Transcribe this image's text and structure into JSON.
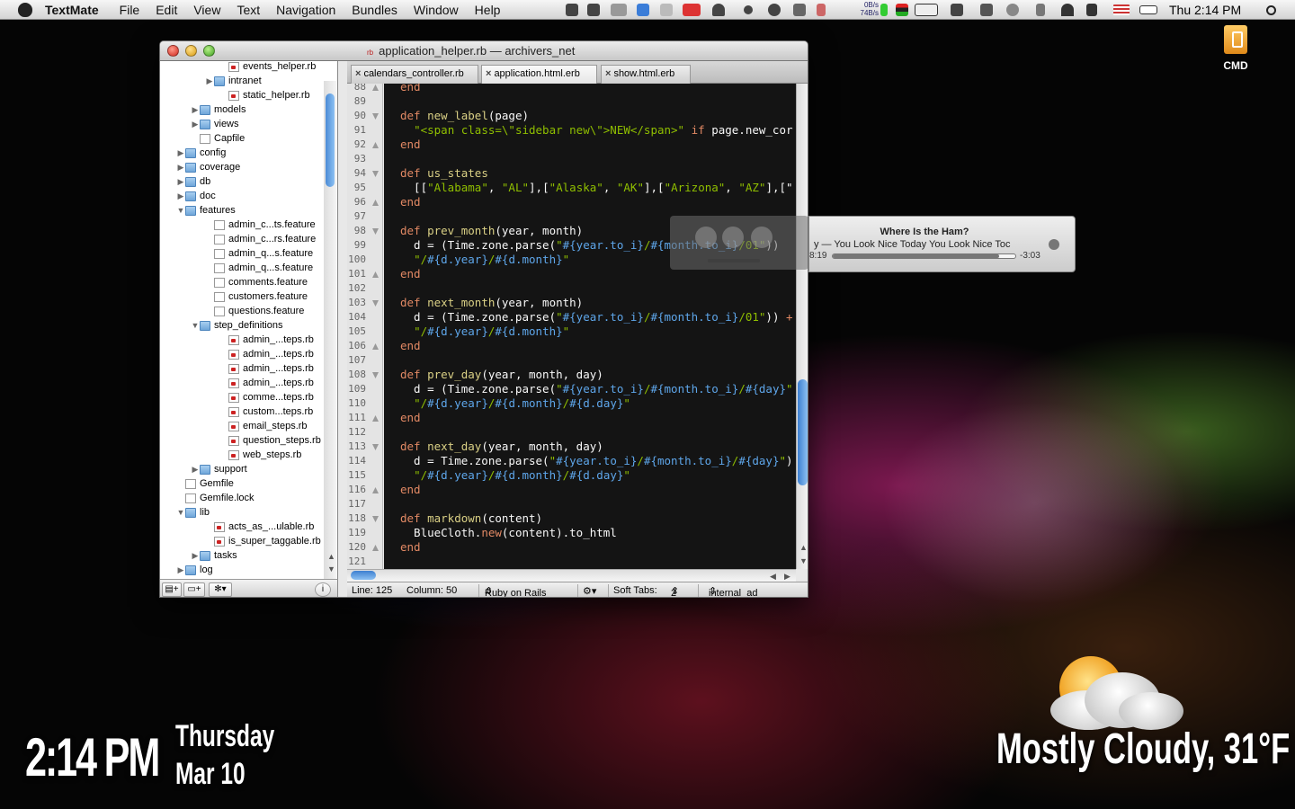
{
  "menubar": {
    "app": "TextMate",
    "items": [
      "File",
      "Edit",
      "View",
      "Text",
      "Navigation",
      "Bundles",
      "Window",
      "Help"
    ],
    "net_up": "0B/s",
    "net_down": "74B/s",
    "clock": "Thu 2:14 PM"
  },
  "desktop": {
    "drive_label": "CMD"
  },
  "window": {
    "title": "application_helper.rb — archivers_net",
    "file_badge": "rb",
    "tabs": [
      "calendars_controller.rb",
      "application.html.erb",
      "show.html.erb"
    ]
  },
  "project_tree": [
    {
      "label": "events_helper.rb",
      "type": "rb",
      "depth": 3
    },
    {
      "label": "intranet",
      "type": "folder",
      "depth": 2,
      "tri": "▶"
    },
    {
      "label": "static_helper.rb",
      "type": "rb",
      "depth": 3
    },
    {
      "label": "models",
      "type": "folder",
      "depth": 1,
      "tri": "▶"
    },
    {
      "label": "views",
      "type": "folder",
      "depth": 1,
      "tri": "▶"
    },
    {
      "label": "Capfile",
      "type": "doc",
      "depth": 1
    },
    {
      "label": "config",
      "type": "folder",
      "depth": 0,
      "tri": "▶"
    },
    {
      "label": "coverage",
      "type": "folder",
      "depth": 0,
      "tri": "▶"
    },
    {
      "label": "db",
      "type": "folder",
      "depth": 0,
      "tri": "▶"
    },
    {
      "label": "doc",
      "type": "folder",
      "depth": 0,
      "tri": "▶"
    },
    {
      "label": "features",
      "type": "folder",
      "depth": 0,
      "tri": "▼"
    },
    {
      "label": "admin_c...ts.feature",
      "type": "doc",
      "depth": 2
    },
    {
      "label": "admin_c...rs.feature",
      "type": "doc",
      "depth": 2
    },
    {
      "label": "admin_q...s.feature",
      "type": "doc",
      "depth": 2
    },
    {
      "label": "admin_q...s.feature",
      "type": "doc",
      "depth": 2
    },
    {
      "label": "comments.feature",
      "type": "doc",
      "depth": 2
    },
    {
      "label": "customers.feature",
      "type": "doc",
      "depth": 2
    },
    {
      "label": "questions.feature",
      "type": "doc",
      "depth": 2
    },
    {
      "label": "step_definitions",
      "type": "folder",
      "depth": 1,
      "tri": "▼"
    },
    {
      "label": "admin_...teps.rb",
      "type": "rb",
      "depth": 3
    },
    {
      "label": "admin_...teps.rb",
      "type": "rb",
      "depth": 3
    },
    {
      "label": "admin_...teps.rb",
      "type": "rb",
      "depth": 3
    },
    {
      "label": "admin_...teps.rb",
      "type": "rb",
      "depth": 3
    },
    {
      "label": "comme...teps.rb",
      "type": "rb",
      "depth": 3
    },
    {
      "label": "custom...teps.rb",
      "type": "rb",
      "depth": 3
    },
    {
      "label": "email_steps.rb",
      "type": "rb",
      "depth": 3
    },
    {
      "label": "question_steps.rb",
      "type": "rb",
      "depth": 3
    },
    {
      "label": "web_steps.rb",
      "type": "rb",
      "depth": 3
    },
    {
      "label": "support",
      "type": "folder",
      "depth": 1,
      "tri": "▶"
    },
    {
      "label": "Gemfile",
      "type": "doc",
      "depth": 0
    },
    {
      "label": "Gemfile.lock",
      "type": "doc",
      "depth": 0
    },
    {
      "label": "lib",
      "type": "folder",
      "depth": 0,
      "tri": "▼"
    },
    {
      "label": "acts_as_...ulable.rb",
      "type": "rb",
      "depth": 2
    },
    {
      "label": "is_super_taggable.rb",
      "type": "rb",
      "depth": 2
    },
    {
      "label": "tasks",
      "type": "folder",
      "depth": 1,
      "tri": "▶"
    },
    {
      "label": "log",
      "type": "folder",
      "depth": 0,
      "tri": "▶"
    }
  ],
  "code": [
    {
      "n": "88",
      "f": "up",
      "t": [
        [
          "kw",
          "end"
        ]
      ]
    },
    {
      "n": "89",
      "t": []
    },
    {
      "n": "90",
      "f": "down",
      "t": [
        [
          "kw",
          "def "
        ],
        [
          "mt",
          "new_label"
        ],
        [
          "",
          "(page)"
        ]
      ]
    },
    {
      "n": "91",
      "t": [
        [
          "",
          "  "
        ],
        [
          "st",
          "\"<span class=\\\"sidebar new\\\">NEW</span>\""
        ],
        [
          "kw",
          " if "
        ],
        [
          "",
          "page.new_cor"
        ]
      ]
    },
    {
      "n": "92",
      "f": "up",
      "t": [
        [
          "kw",
          "end"
        ]
      ]
    },
    {
      "n": "93",
      "t": []
    },
    {
      "n": "94",
      "f": "down",
      "t": [
        [
          "kw",
          "def "
        ],
        [
          "mt",
          "us_states"
        ]
      ]
    },
    {
      "n": "95",
      "t": [
        [
          "",
          "  [["
        ],
        [
          "st",
          "\"Alabama\""
        ],
        [
          "",
          ", "
        ],
        [
          "st",
          "\"AL\""
        ],
        [
          "",
          "],["
        ],
        [
          "st",
          "\"Alaska\""
        ],
        [
          "",
          ", "
        ],
        [
          "st",
          "\"AK\""
        ],
        [
          "",
          "],["
        ],
        [
          "st",
          "\"Arizona\""
        ],
        [
          "",
          ", "
        ],
        [
          "st",
          "\"AZ\""
        ],
        [
          "",
          "],[\""
        ]
      ]
    },
    {
      "n": "96",
      "f": "up",
      "t": [
        [
          "kw",
          "end"
        ]
      ]
    },
    {
      "n": "97",
      "t": []
    },
    {
      "n": "98",
      "f": "down",
      "t": [
        [
          "kw",
          "def "
        ],
        [
          "mt",
          "prev_month"
        ],
        [
          "",
          "(year, month)"
        ]
      ]
    },
    {
      "n": "99",
      "t": [
        [
          "",
          "  d = (Time.zone.parse("
        ],
        [
          "st",
          "\""
        ],
        [
          "in",
          "#{year.to_i}"
        ],
        [
          "st",
          "/"
        ],
        [
          "in",
          "#{month.to_i}"
        ],
        [
          "st",
          "/01\""
        ],
        [
          "",
          "))"
        ]
      ]
    },
    {
      "n": "100",
      "t": [
        [
          "",
          "  "
        ],
        [
          "st",
          "\"/"
        ],
        [
          "in",
          "#{d.year}"
        ],
        [
          "st",
          "/"
        ],
        [
          "in",
          "#{d.month}"
        ],
        [
          "st",
          "\""
        ]
      ]
    },
    {
      "n": "101",
      "f": "up",
      "t": [
        [
          "kw",
          "end"
        ]
      ]
    },
    {
      "n": "102",
      "t": []
    },
    {
      "n": "103",
      "f": "down",
      "t": [
        [
          "kw",
          "def "
        ],
        [
          "mt",
          "next_month"
        ],
        [
          "",
          "(year, month)"
        ]
      ]
    },
    {
      "n": "104",
      "t": [
        [
          "",
          "  d = (Time.zone.parse("
        ],
        [
          "st",
          "\""
        ],
        [
          "in",
          "#{year.to_i}"
        ],
        [
          "st",
          "/"
        ],
        [
          "in",
          "#{month.to_i}"
        ],
        [
          "st",
          "/01\""
        ],
        [
          "",
          ")) "
        ],
        [
          "kw",
          "+"
        ]
      ]
    },
    {
      "n": "105",
      "t": [
        [
          "",
          "  "
        ],
        [
          "st",
          "\"/"
        ],
        [
          "in",
          "#{d.year}"
        ],
        [
          "st",
          "/"
        ],
        [
          "in",
          "#{d.month}"
        ],
        [
          "st",
          "\""
        ]
      ]
    },
    {
      "n": "106",
      "f": "up",
      "t": [
        [
          "kw",
          "end"
        ]
      ]
    },
    {
      "n": "107",
      "t": []
    },
    {
      "n": "108",
      "f": "down",
      "t": [
        [
          "kw",
          "def "
        ],
        [
          "mt",
          "prev_day"
        ],
        [
          "",
          "(year, month, day)"
        ]
      ]
    },
    {
      "n": "109",
      "t": [
        [
          "",
          "  d = (Time.zone.parse("
        ],
        [
          "st",
          "\""
        ],
        [
          "in",
          "#{year.to_i}"
        ],
        [
          "st",
          "/"
        ],
        [
          "in",
          "#{month.to_i}"
        ],
        [
          "st",
          "/"
        ],
        [
          "in",
          "#{day}"
        ],
        [
          "st",
          "\""
        ]
      ]
    },
    {
      "n": "110",
      "t": [
        [
          "",
          "  "
        ],
        [
          "st",
          "\"/"
        ],
        [
          "in",
          "#{d.year}"
        ],
        [
          "st",
          "/"
        ],
        [
          "in",
          "#{d.month}"
        ],
        [
          "st",
          "/"
        ],
        [
          "in",
          "#{d.day}"
        ],
        [
          "st",
          "\""
        ]
      ]
    },
    {
      "n": "111",
      "f": "up",
      "t": [
        [
          "kw",
          "end"
        ]
      ]
    },
    {
      "n": "112",
      "t": []
    },
    {
      "n": "113",
      "f": "down",
      "t": [
        [
          "kw",
          "def "
        ],
        [
          "mt",
          "next_day"
        ],
        [
          "",
          "(year, month, day)"
        ]
      ]
    },
    {
      "n": "114",
      "t": [
        [
          "",
          "  d = Time.zone.parse("
        ],
        [
          "st",
          "\""
        ],
        [
          "in",
          "#{year.to_i}"
        ],
        [
          "st",
          "/"
        ],
        [
          "in",
          "#{month.to_i}"
        ],
        [
          "st",
          "/"
        ],
        [
          "in",
          "#{day}"
        ],
        [
          "st",
          "\""
        ],
        [
          "",
          ")"
        ]
      ]
    },
    {
      "n": "115",
      "t": [
        [
          "",
          "  "
        ],
        [
          "st",
          "\"/"
        ],
        [
          "in",
          "#{d.year}"
        ],
        [
          "st",
          "/"
        ],
        [
          "in",
          "#{d.month}"
        ],
        [
          "st",
          "/"
        ],
        [
          "in",
          "#{d.day}"
        ],
        [
          "st",
          "\""
        ]
      ]
    },
    {
      "n": "116",
      "f": "up",
      "t": [
        [
          "kw",
          "end"
        ]
      ]
    },
    {
      "n": "117",
      "t": []
    },
    {
      "n": "118",
      "f": "down",
      "t": [
        [
          "kw",
          "def "
        ],
        [
          "mt",
          "markdown"
        ],
        [
          "",
          "(content)"
        ]
      ]
    },
    {
      "n": "119",
      "t": [
        [
          "",
          "  BlueCloth."
        ],
        [
          "kw",
          "new"
        ],
        [
          "",
          "(content).to_html"
        ]
      ]
    },
    {
      "n": "120",
      "f": "up",
      "t": [
        [
          "kw",
          "end"
        ]
      ]
    },
    {
      "n": "121",
      "t": []
    }
  ],
  "statusbar": {
    "line": "Line: 125",
    "column": "Column: 50",
    "language": "Ruby on Rails",
    "soft_tabs": "Soft Tabs:",
    "tab_size": "2",
    "symbol": "internal_ad"
  },
  "itunes": {
    "title": "Where Is the Ham?",
    "subtitle": "y — You Look Nice Today   You Look Nice Toc",
    "elapsed": "8:19",
    "remaining": "-3:03",
    "progress": 0.91
  },
  "geektool": {
    "time": "2:14 PM",
    "day": "Thursday",
    "date": "Mar 10",
    "weather": "Mostly Cloudy, 31°F"
  },
  "colors": {
    "keyword": "#e28964",
    "string": "#8fbe00",
    "interpolation": "#5ea6ea",
    "method": "#dad085",
    "code_bg": "#141414"
  }
}
